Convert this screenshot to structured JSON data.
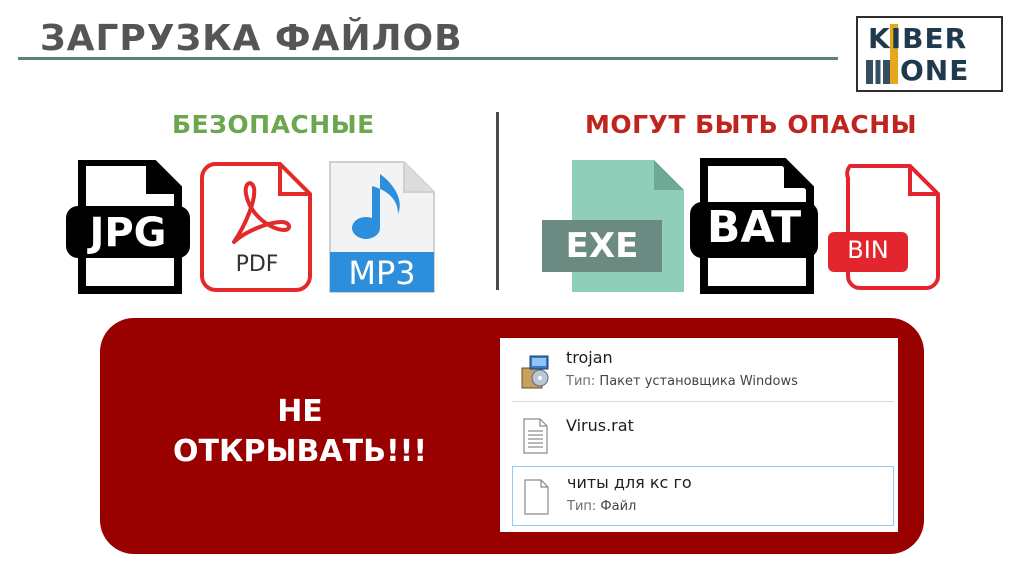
{
  "title": "ЗАГРУЗКА ФАЙЛОВ",
  "logo": {
    "line1": "KIBER",
    "line2": "ONE"
  },
  "colors": {
    "safe": "#6aa74f",
    "danger": "#c0241f",
    "panel": "#990000",
    "accent": "#5f7f7c"
  },
  "safe": {
    "heading": "БЕЗОПАСНЫЕ",
    "files": [
      {
        "label": "JPG",
        "icon": "jpg-file-icon"
      },
      {
        "label": "PDF",
        "icon": "pdf-file-icon"
      },
      {
        "label": "MP3",
        "icon": "mp3-file-icon"
      }
    ]
  },
  "danger": {
    "heading": "МОГУТ БЫТЬ ОПАСНЫ",
    "files": [
      {
        "label": "EXE",
        "icon": "exe-file-icon"
      },
      {
        "label": "BAT",
        "icon": "bat-file-icon"
      },
      {
        "label": "BIN",
        "icon": "bin-file-icon"
      }
    ]
  },
  "warning": {
    "line1": "НЕ",
    "line2": "ОТКРЫВАТЬ!!!"
  },
  "explorer": {
    "type_key": "Тип:",
    "items": [
      {
        "name": "trojan",
        "type": "Пакет установщика Windows",
        "icon": "installer-package-icon"
      },
      {
        "name": "Virus.rat",
        "type": "",
        "icon": "text-document-icon"
      },
      {
        "name": "читы для кс го",
        "type": "Файл",
        "icon": "blank-file-icon"
      }
    ]
  }
}
